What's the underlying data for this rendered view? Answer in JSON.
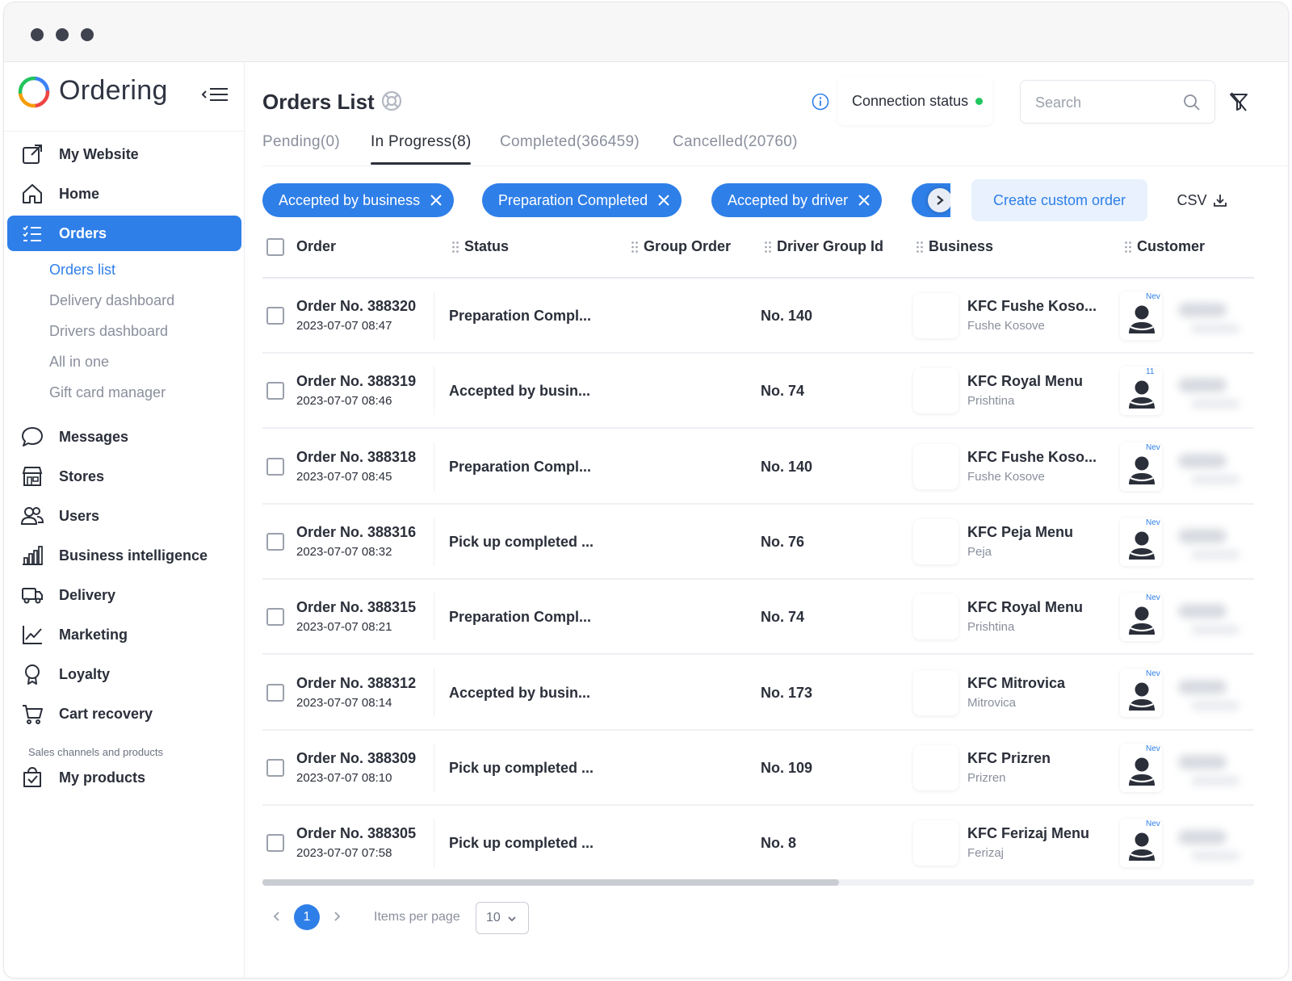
{
  "brand": {
    "name": "Ordering"
  },
  "sidebar": {
    "items": [
      {
        "key": "my-website",
        "label": "My Website",
        "icon": "external-link-icon"
      },
      {
        "key": "home",
        "label": "Home",
        "icon": "home-icon"
      },
      {
        "key": "orders",
        "label": "Orders",
        "icon": "list-icon",
        "active": true
      },
      {
        "key": "messages",
        "label": "Messages",
        "icon": "chat-bubble-icon"
      },
      {
        "key": "stores",
        "label": "Stores",
        "icon": "store-icon"
      },
      {
        "key": "users",
        "label": "Users",
        "icon": "users-icon"
      },
      {
        "key": "business-intelligence",
        "label": "Business intelligence",
        "icon": "bar-chart-icon"
      },
      {
        "key": "delivery",
        "label": "Delivery",
        "icon": "truck-icon"
      },
      {
        "key": "marketing",
        "label": "Marketing",
        "icon": "line-chart-icon"
      },
      {
        "key": "loyalty",
        "label": "Loyalty",
        "icon": "medal-icon"
      },
      {
        "key": "cart-recovery",
        "label": "Cart recovery",
        "icon": "cart-icon"
      },
      {
        "key": "my-products",
        "label": "My products",
        "icon": "bag-check-icon"
      }
    ],
    "orders_sub": [
      "Orders list",
      "Delivery dashboard",
      "Drivers dashboard",
      "All in one",
      "Gift card manager"
    ],
    "section_label": "Sales channels and products"
  },
  "header": {
    "title": "Orders List",
    "connection_status": "Connection status",
    "connection_color": "#22c55e",
    "search_placeholder": "Search"
  },
  "tabs": [
    {
      "label": "Pending(0)"
    },
    {
      "label": "In Progress(8)",
      "active": true
    },
    {
      "label": "Completed(366459)"
    },
    {
      "label": "Cancelled(20760)"
    }
  ],
  "filters": [
    "Accepted by business",
    "Preparation Completed",
    "Accepted by driver"
  ],
  "actions": {
    "create_custom_order": "Create custom order",
    "csv": "CSV"
  },
  "columns": [
    "Order",
    "Status",
    "Group Order",
    "Driver Group Id",
    "Business",
    "Customer"
  ],
  "orders": [
    {
      "number": "Order No. 388320",
      "date": "2023-07-07 08:47",
      "status": "Preparation Compl...",
      "driver_group": "No. 140",
      "business": "KFC Fushe Koso...",
      "city": "Fushe Kosove",
      "badge": "Nev"
    },
    {
      "number": "Order No. 388319",
      "date": "2023-07-07 08:46",
      "status": "Accepted by busin...",
      "driver_group": "No. 74",
      "business": "KFC Royal Menu",
      "city": "Prishtina",
      "badge": "11"
    },
    {
      "number": "Order No. 388318",
      "date": "2023-07-07 08:45",
      "status": "Preparation Compl...",
      "driver_group": "No. 140",
      "business": "KFC Fushe Koso...",
      "city": "Fushe Kosove",
      "badge": "Nev"
    },
    {
      "number": "Order No. 388316",
      "date": "2023-07-07 08:32",
      "status": "Pick up completed ...",
      "driver_group": "No. 76",
      "business": "KFC Peja Menu",
      "city": "Peja",
      "badge": "Nev"
    },
    {
      "number": "Order No. 388315",
      "date": "2023-07-07 08:21",
      "status": "Preparation Compl...",
      "driver_group": "No. 74",
      "business": "KFC Royal Menu",
      "city": "Prishtina",
      "badge": "Nev"
    },
    {
      "number": "Order No. 388312",
      "date": "2023-07-07 08:14",
      "status": "Accepted by busin...",
      "driver_group": "No. 173",
      "business": "KFC Mitrovica",
      "city": "Mitrovica",
      "badge": "Nev"
    },
    {
      "number": "Order No. 388309",
      "date": "2023-07-07 08:10",
      "status": "Pick up completed ...",
      "driver_group": "No. 109",
      "business": "KFC Prizren",
      "city": "Prizren",
      "badge": "Nev"
    },
    {
      "number": "Order No. 388305",
      "date": "2023-07-07 07:58",
      "status": "Pick up completed ...",
      "driver_group": "No. 8",
      "business": "KFC Ferizaj Menu",
      "city": "Ferizaj",
      "badge": "Nev"
    }
  ],
  "pagination": {
    "current_page": "1",
    "items_per_page_label": "Items per page",
    "items_per_page": "10"
  },
  "colors": {
    "accent": "#2f7fe8",
    "text": "#2b2f3a",
    "muted": "#8a8f9c"
  }
}
